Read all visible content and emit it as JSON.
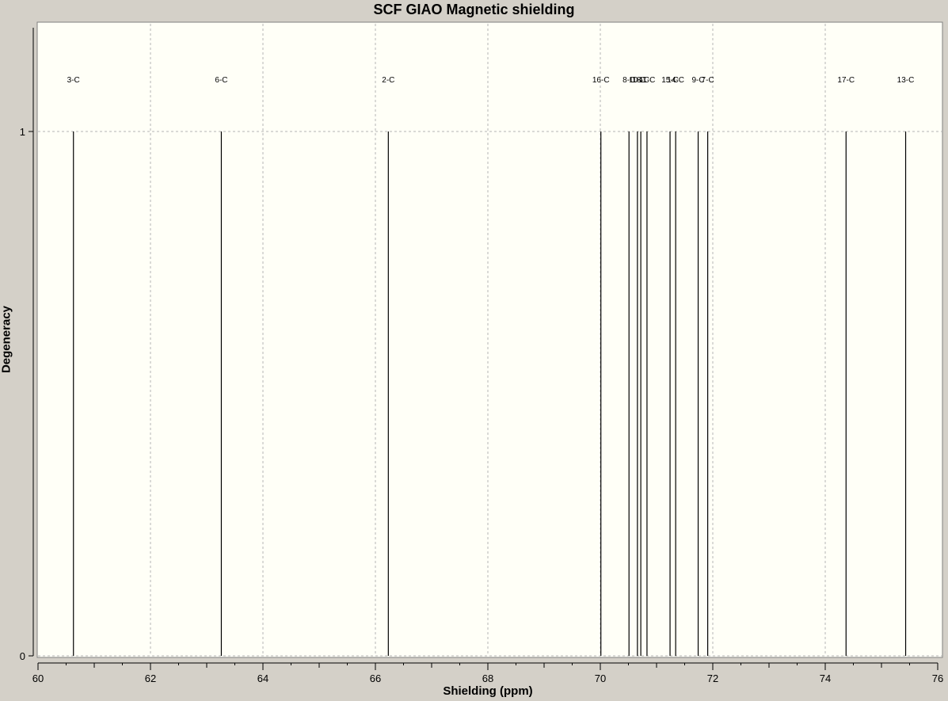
{
  "title": "SCF GIAO Magnetic shielding",
  "chart_data": {
    "type": "bar",
    "title": "SCF GIAO Magnetic shielding",
    "xlabel": "Shielding (ppm)",
    "ylabel": "Degeneracy",
    "xlim": [
      60,
      76
    ],
    "ylim": [
      0,
      1
    ],
    "x_ticks": [
      "60",
      "62",
      "64",
      "66",
      "68",
      "70",
      "72",
      "74",
      "76"
    ],
    "y_ticks": [
      "0",
      "1"
    ],
    "grid": true,
    "peaks": [
      {
        "label": "3-C",
        "x": 60.63,
        "y": 1
      },
      {
        "label": "6-C",
        "x": 63.26,
        "y": 1
      },
      {
        "label": "2-C",
        "x": 66.23,
        "y": 1
      },
      {
        "label": "16-C",
        "x": 70.01,
        "y": 1
      },
      {
        "label": "8-C",
        "x": 70.51,
        "y": 1
      },
      {
        "label": "10-C",
        "x": 70.66,
        "y": 1
      },
      {
        "label": "18-C",
        "x": 70.72,
        "y": 1
      },
      {
        "label": "11-C",
        "x": 70.83,
        "y": 1
      },
      {
        "label": "15-C",
        "x": 71.24,
        "y": 1
      },
      {
        "label": "14-C",
        "x": 71.34,
        "y": 1
      },
      {
        "label": "9-C",
        "x": 71.74,
        "y": 1
      },
      {
        "label": "7-C",
        "x": 71.91,
        "y": 1
      },
      {
        "label": "17-C",
        "x": 74.37,
        "y": 1
      },
      {
        "label": "13-C",
        "x": 75.43,
        "y": 1
      }
    ]
  },
  "colors": {
    "plot_background": "#fffff7",
    "window_background": "#d4d0c8",
    "peak": "#000000",
    "grid": "#b4b4b4"
  }
}
